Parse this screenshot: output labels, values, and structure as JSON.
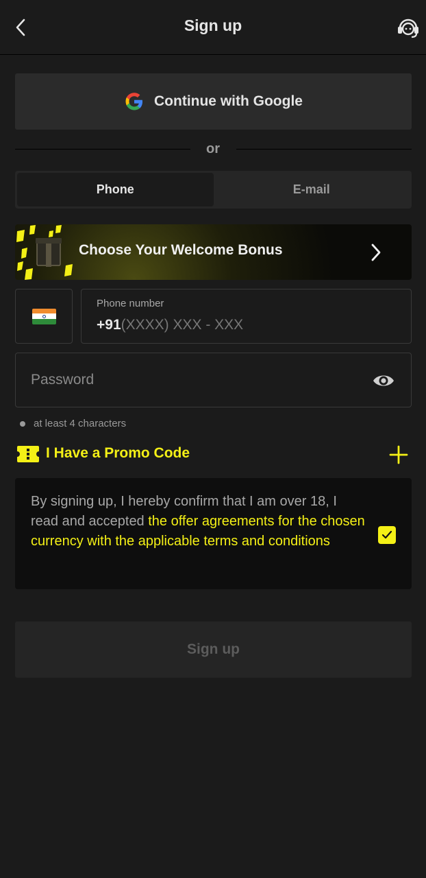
{
  "header": {
    "title": "Sign up"
  },
  "google": {
    "label": "Continue with Google"
  },
  "separator": {
    "text": "or"
  },
  "tabs": [
    {
      "label": "Phone",
      "active": true
    },
    {
      "label": "E-mail",
      "active": false
    }
  ],
  "bonus": {
    "label": "Choose Your Welcome Bonus"
  },
  "phone": {
    "label": "Phone number",
    "prefix": "+91",
    "placeholder": "(XXXX) XXX - XXX",
    "country_flag": "india-flag-icon"
  },
  "password": {
    "placeholder": "Password"
  },
  "password_hint": "at least 4 characters",
  "promo": {
    "label": "I Have a Promo Code"
  },
  "terms": {
    "text_plain": "By signing up, I hereby confirm that I am over 18, I read and accepted ",
    "text_link": "the offer agreements for the chosen currency with the applicable terms and conditions",
    "checked": true
  },
  "submit": {
    "label": "Sign up"
  },
  "colors": {
    "accent": "#f4f016",
    "background": "#1b1b1b",
    "panel": "#2b2b2b"
  }
}
